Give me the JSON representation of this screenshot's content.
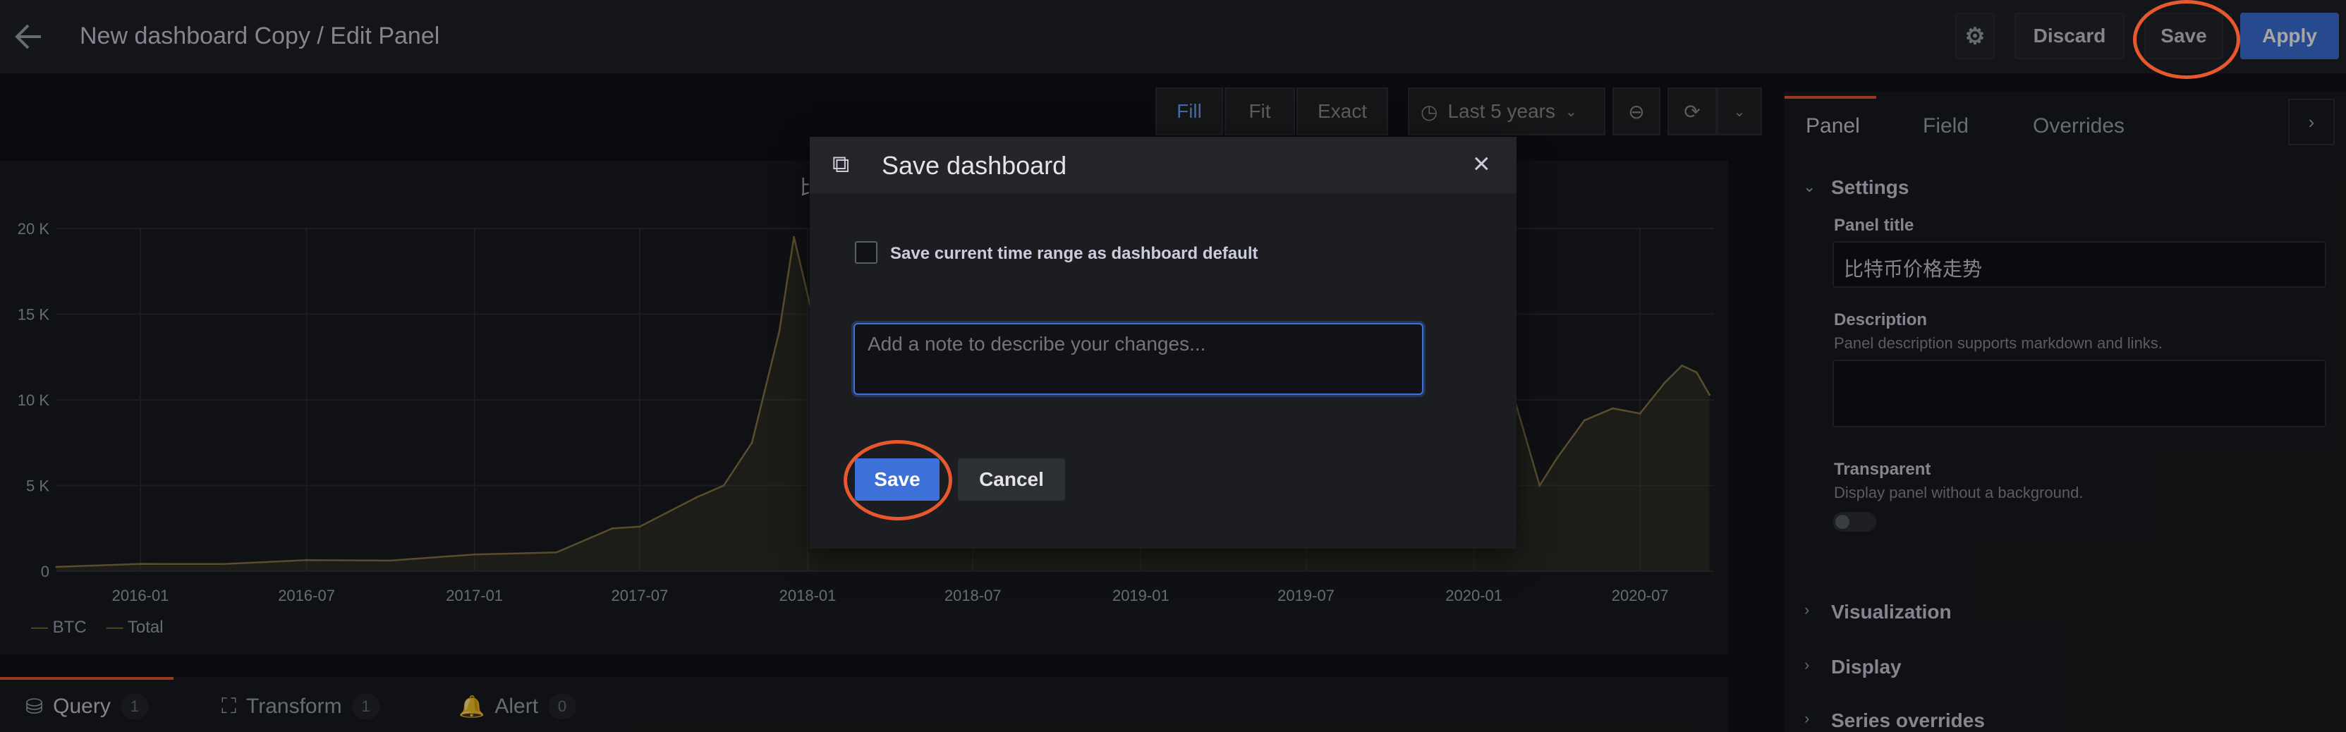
{
  "topbar": {
    "title": "New dashboard Copy / Edit Panel",
    "discard_label": "Discard",
    "save_label": "Save",
    "apply_label": "Apply"
  },
  "toolbar": {
    "fill_label": "Fill",
    "fit_label": "Fit",
    "exact_label": "Exact",
    "time_range": "Last 5 years"
  },
  "chart_data": {
    "type": "area",
    "x": [
      "2015-10-01",
      "2016-01-01",
      "2016-04-01",
      "2016-07-01",
      "2016-10-01",
      "2017-01-01",
      "2017-04-01",
      "2017-06-01",
      "2017-07-01",
      "2017-09-01",
      "2017-10-01",
      "2017-11-01",
      "2017-12-01",
      "2017-12-17",
      "2018-01-15",
      "2018-02-06",
      "2018-03-01",
      "2018-06-01",
      "2018-09-01",
      "2018-11-20",
      "2019-02-01",
      "2019-04-01",
      "2019-06-26",
      "2019-08-01",
      "2019-10-01",
      "2019-12-01",
      "2020-01-01",
      "2020-02-13",
      "2020-03-13",
      "2020-04-01",
      "2020-05-01",
      "2020-06-01",
      "2020-07-01",
      "2020-07-28",
      "2020-08-16",
      "2020-09-01",
      "2020-09-15"
    ],
    "series": [
      {
        "name": "BTC",
        "values": [
          250,
          430,
          420,
          650,
          620,
          980,
          1100,
          2500,
          2600,
          4300,
          5000,
          7500,
          14000,
          19500,
          13000,
          7000,
          10500,
          6400,
          6500,
          4000,
          3500,
          4100,
          12500,
          10200,
          8300,
          7400,
          7200,
          10300,
          5000,
          6600,
          8800,
          9500,
          9200,
          11000,
          12000,
          11600,
          10300
        ]
      }
    ],
    "xticks": [
      "2016-01",
      "2016-07",
      "2017-01",
      "2017-07",
      "2018-01",
      "2018-07",
      "2019-01",
      "2019-07",
      "2020-01",
      "2020-07"
    ],
    "yticks": [
      "0",
      "5 K",
      "10 K",
      "15 K",
      "20 K"
    ],
    "ylim": [
      0,
      20000
    ],
    "legend": [
      "BTC",
      "Total"
    ],
    "title_partial": "比",
    "grid": true
  },
  "bottom_tabs": [
    {
      "label": "Query",
      "count": "1"
    },
    {
      "label": "Transform",
      "count": "1"
    },
    {
      "label": "Alert",
      "count": "0"
    }
  ],
  "right_panel": {
    "tabs": [
      "Panel",
      "Field",
      "Overrides"
    ],
    "settings_label": "Settings",
    "panel_title_label": "Panel title",
    "panel_title_value": "比特币价格走势",
    "description_label": "Description",
    "description_hint": "Panel description supports markdown and links.",
    "transparent_label": "Transparent",
    "transparent_hint": "Display panel without a background.",
    "visualization_label": "Visualization",
    "display_label": "Display",
    "series_overrides_label": "Series overrides"
  },
  "modal": {
    "title": "Save dashboard",
    "checkbox_label": "Save current time range as dashboard default",
    "note_placeholder": "Add a note to describe your changes...",
    "save_label": "Save",
    "cancel_label": "Cancel",
    "close_glyph": "×"
  },
  "colors": {
    "accent_blue": "#3d71d9",
    "series_color": "#8a7748",
    "highlight": "#e8582f"
  }
}
